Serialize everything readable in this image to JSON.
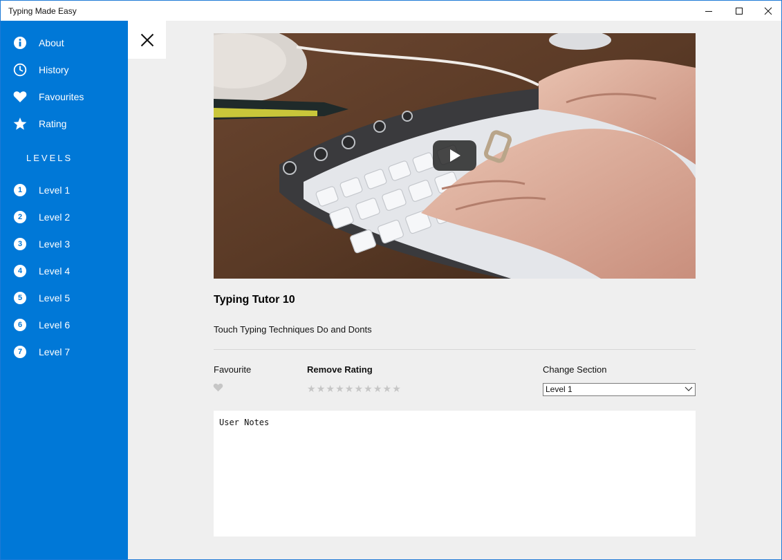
{
  "window": {
    "title": "Typing Made Easy",
    "controls": [
      "minimize-icon",
      "maximize-icon",
      "close-icon"
    ]
  },
  "sidebar": {
    "accent": "#0078d7",
    "items": [
      {
        "label": "About",
        "icon": "info-icon"
      },
      {
        "label": "History",
        "icon": "clock-icon"
      },
      {
        "label": "Favourites",
        "icon": "heart-icon"
      },
      {
        "label": "Rating",
        "icon": "star-icon"
      }
    ],
    "levels_heading": "LEVELS",
    "levels": [
      {
        "num": "1",
        "label": "Level 1"
      },
      {
        "num": "2",
        "label": "Level 2"
      },
      {
        "num": "3",
        "label": "Level 3"
      },
      {
        "num": "4",
        "label": "Level 4"
      },
      {
        "num": "5",
        "label": "Level 5"
      },
      {
        "num": "6",
        "label": "Level 6"
      },
      {
        "num": "7",
        "label": "Level 7"
      }
    ]
  },
  "detail": {
    "close_icon": "close-icon",
    "video_icon": "play-icon",
    "title": "Typing Tutor 10",
    "description": "Touch Typing Techniques Do and Donts",
    "favourite_label": "Favourite",
    "rating_label": "Remove Rating",
    "rating_stars": 10,
    "rating_value": 0,
    "section_label": "Change Section",
    "section_selected": "Level 1",
    "notes_placeholder": "User Notes"
  }
}
